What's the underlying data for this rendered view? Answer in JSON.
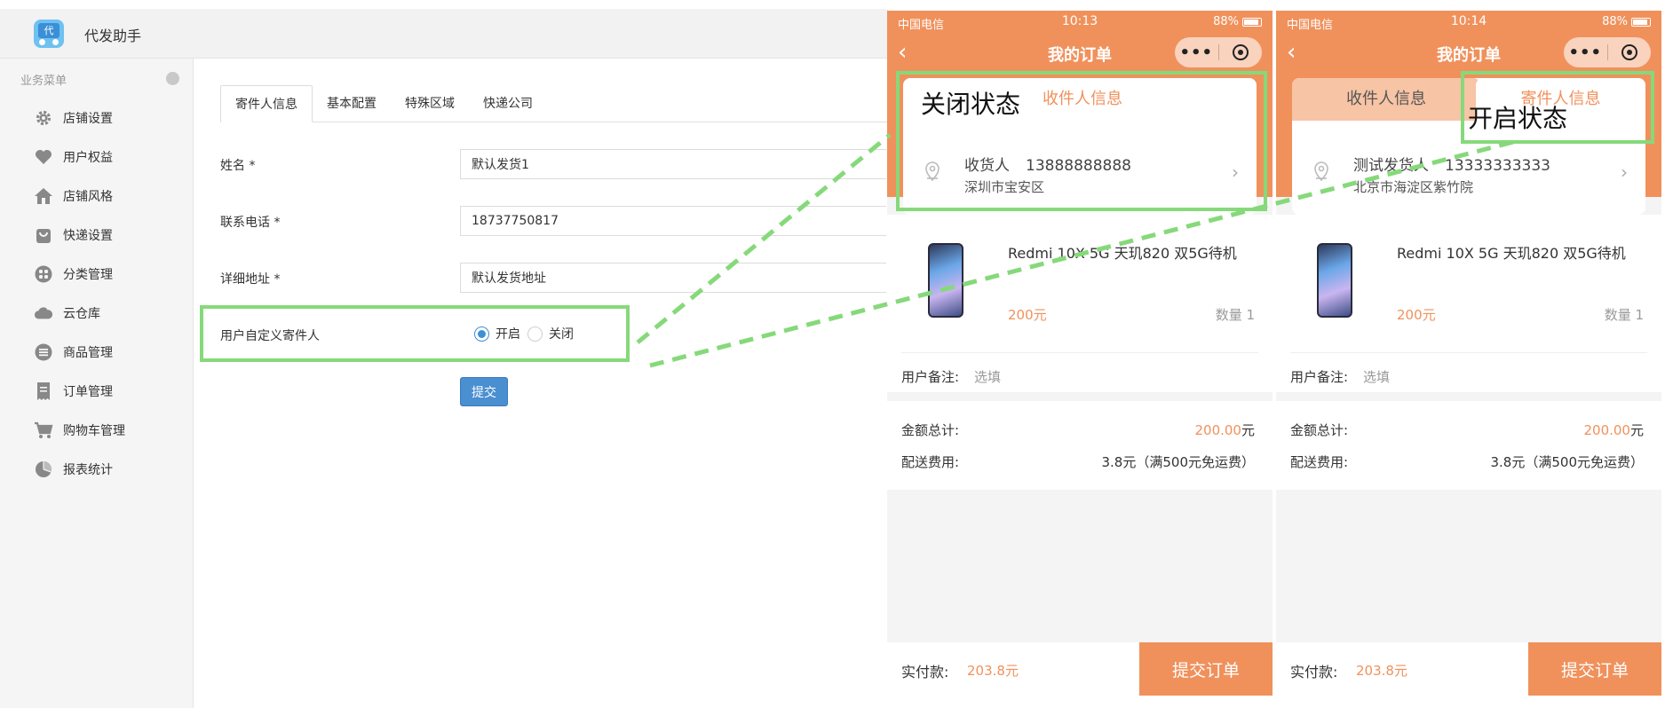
{
  "app": {
    "title": "代发助手",
    "logo_text": "代"
  },
  "sidebar": {
    "header": "业务菜单",
    "items": [
      {
        "label": "店铺设置",
        "icon": "gear-icon"
      },
      {
        "label": "用户权益",
        "icon": "heart-icon"
      },
      {
        "label": "店铺风格",
        "icon": "home-icon"
      },
      {
        "label": "快递设置",
        "icon": "bag-icon"
      },
      {
        "label": "分类管理",
        "icon": "grid-icon"
      },
      {
        "label": "云仓库",
        "icon": "cloud-icon"
      },
      {
        "label": "商品管理",
        "icon": "list-icon"
      },
      {
        "label": "订单管理",
        "icon": "receipt-icon"
      },
      {
        "label": "购物车管理",
        "icon": "cart-icon"
      },
      {
        "label": "报表统计",
        "icon": "pie-chart-icon"
      }
    ]
  },
  "tabs": [
    {
      "label": "寄件人信息",
      "active": true
    },
    {
      "label": "基本配置",
      "active": false
    },
    {
      "label": "特殊区域",
      "active": false
    },
    {
      "label": "快递公司",
      "active": false
    }
  ],
  "form": {
    "name": {
      "label": "姓名 *",
      "value": "默认发货1"
    },
    "phone": {
      "label": "联系电话 *",
      "value": "18737750817"
    },
    "address": {
      "label": "详细地址 *",
      "value": "默认发货地址"
    },
    "custom_sender": {
      "label": "用户自定义寄件人",
      "option_on": "开启",
      "option_off": "关闭",
      "selected": "开启"
    },
    "submit_label": "提交"
  },
  "phones": [
    {
      "status": {
        "carrier": "中国电信",
        "time": "10:13",
        "battery": "88%"
      },
      "nav_title": "我的订单",
      "callout": "关闭状态",
      "address_tabs": [
        "收件人信息"
      ],
      "address": {
        "name": "收货人",
        "phone": "13888888888",
        "line": "深圳市宝安区"
      },
      "product": {
        "name": "Redmi 10X 5G 天玑820 双5G待机",
        "price": "200元",
        "qty": "数量 1"
      },
      "remark": {
        "label": "用户备注:",
        "value": "选填"
      },
      "summary": {
        "total_label": "金额总计:",
        "total_value": "200.00",
        "total_unit": "元",
        "shipping_label": "配送费用:",
        "shipping_value": "3.8元（满500元免运费）"
      },
      "pay": {
        "label": "实付款:",
        "value": "203.8元"
      },
      "order_button": "提交订单"
    },
    {
      "status": {
        "carrier": "中国电信",
        "time": "10:14",
        "battery": "88%"
      },
      "nav_title": "我的订单",
      "callout": "开启状态",
      "address_tabs": [
        "收件人信息",
        "寄件人信息"
      ],
      "address": {
        "name": "测试发货人",
        "phone": "13333333333",
        "line": "北京市海淀区紫竹院"
      },
      "product": {
        "name": "Redmi 10X 5G 天玑820 双5G待机",
        "price": "200元",
        "qty": "数量 1"
      },
      "remark": {
        "label": "用户备注:",
        "value": "选填"
      },
      "summary": {
        "total_label": "金额总计:",
        "total_value": "200.00",
        "total_unit": "元",
        "shipping_label": "配送费用:",
        "shipping_value": "3.8元（满500元免运费）"
      },
      "pay": {
        "label": "实付款:",
        "value": "203.8元"
      },
      "order_button": "提交订单"
    }
  ],
  "colors": {
    "accent": "#f0915c",
    "highlight": "#86d97a",
    "primary": "#4a8fd0"
  }
}
